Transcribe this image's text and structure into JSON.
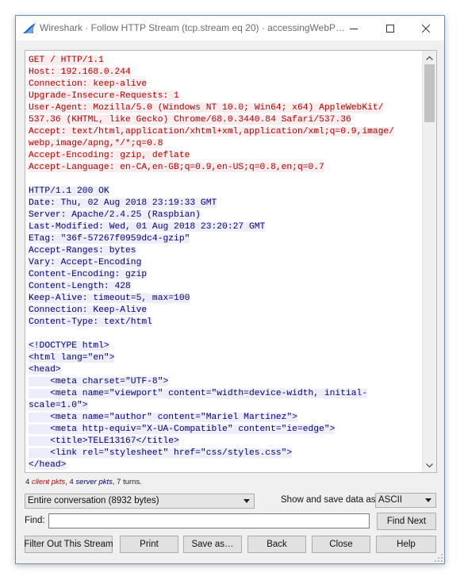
{
  "window": {
    "title": "Wireshark · Follow HTTP Stream (tcp.stream eq 20) · accessingWebP…"
  },
  "stream": {
    "lines": [
      {
        "dir": "client",
        "text": "GET / HTTP/1.1"
      },
      {
        "dir": "client",
        "text": "Host: 192.168.0.244"
      },
      {
        "dir": "client",
        "text": "Connection: keep-alive"
      },
      {
        "dir": "client",
        "text": "Upgrade-Insecure-Requests: 1"
      },
      {
        "dir": "client",
        "text": "User-Agent: Mozilla/5.0 (Windows NT 10.0; Win64; x64) AppleWebKit/"
      },
      {
        "dir": "client",
        "text": "537.36 (KHTML, like Gecko) Chrome/68.0.3440.84 Safari/537.36"
      },
      {
        "dir": "client",
        "text": "Accept: text/html,application/xhtml+xml,application/xml;q=0.9,image/"
      },
      {
        "dir": "client",
        "text": "webp,image/apng,*/*;q=0.8"
      },
      {
        "dir": "client",
        "text": "Accept-Encoding: gzip, deflate"
      },
      {
        "dir": "client",
        "text": "Accept-Language: en-CA,en-GB;q=0.9,en-US;q=0.8,en;q=0.7"
      },
      {
        "dir": "blank",
        "text": ""
      },
      {
        "dir": "server",
        "text": "HTTP/1.1 200 OK"
      },
      {
        "dir": "server",
        "text": "Date: Thu, 02 Aug 2018 23:19:33 GMT"
      },
      {
        "dir": "server",
        "text": "Server: Apache/2.4.25 (Raspbian)"
      },
      {
        "dir": "server",
        "text": "Last-Modified: Wed, 01 Aug 2018 23:20:27 GMT"
      },
      {
        "dir": "server",
        "text": "ETag: \"36f-57267f0959dc4-gzip\""
      },
      {
        "dir": "server",
        "text": "Accept-Ranges: bytes"
      },
      {
        "dir": "server",
        "text": "Vary: Accept-Encoding"
      },
      {
        "dir": "server",
        "text": "Content-Encoding: gzip"
      },
      {
        "dir": "server",
        "text": "Content-Length: 428"
      },
      {
        "dir": "server",
        "text": "Keep-Alive: timeout=5, max=100"
      },
      {
        "dir": "server",
        "text": "Connection: Keep-Alive"
      },
      {
        "dir": "server",
        "text": "Content-Type: text/html"
      },
      {
        "dir": "blank",
        "text": ""
      },
      {
        "dir": "server",
        "text": "<!DOCTYPE html>"
      },
      {
        "dir": "server",
        "text": "<html lang=\"en\">"
      },
      {
        "dir": "server",
        "text": "<head>"
      },
      {
        "dir": "server",
        "text": "    <meta charset=\"UTF-8\">"
      },
      {
        "dir": "server",
        "text": "    <meta name=\"viewport\" content=\"width=device-width, initial-"
      },
      {
        "dir": "server",
        "text": "scale=1.0\">"
      },
      {
        "dir": "server",
        "text": "    <meta name=\"author\" content=\"Mariel Martinez\">"
      },
      {
        "dir": "server",
        "text": "    <meta http-equiv=\"X-UA-Compatible\" content=\"ie=edge\">"
      },
      {
        "dir": "server",
        "text": "    <title>TELE13167</title>"
      },
      {
        "dir": "server",
        "text": "    <link rel=\"stylesheet\" href=\"css/styles.css\">"
      },
      {
        "dir": "server",
        "text": "</head>"
      }
    ]
  },
  "stats": {
    "client_count": "4",
    "client_label": "client pkts",
    "sep1": ", ",
    "server_count": "4",
    "server_label": "server pkts",
    "turns": ", 7 turns."
  },
  "conversation_select": {
    "value": "Entire conversation (8932 bytes)"
  },
  "show_data": {
    "label": "Show and save data as",
    "value": "ASCII"
  },
  "find": {
    "label": "Find:",
    "value": "",
    "button": "Find Next"
  },
  "buttons": {
    "filter_out": "Filter Out This Stream",
    "print": "Print",
    "save_as": "Save as…",
    "back": "Back",
    "close": "Close",
    "help": "Help"
  },
  "colors": {
    "client_text": "#b40000",
    "client_bg": "#fbeded",
    "server_text": "#000080",
    "server_bg": "#ededfb",
    "icon_blue": "#1b6ac9"
  },
  "icons": {
    "app": "wireshark-fin-icon",
    "minimize": "minimize-icon",
    "maximize": "maximize-icon",
    "close": "close-icon"
  }
}
